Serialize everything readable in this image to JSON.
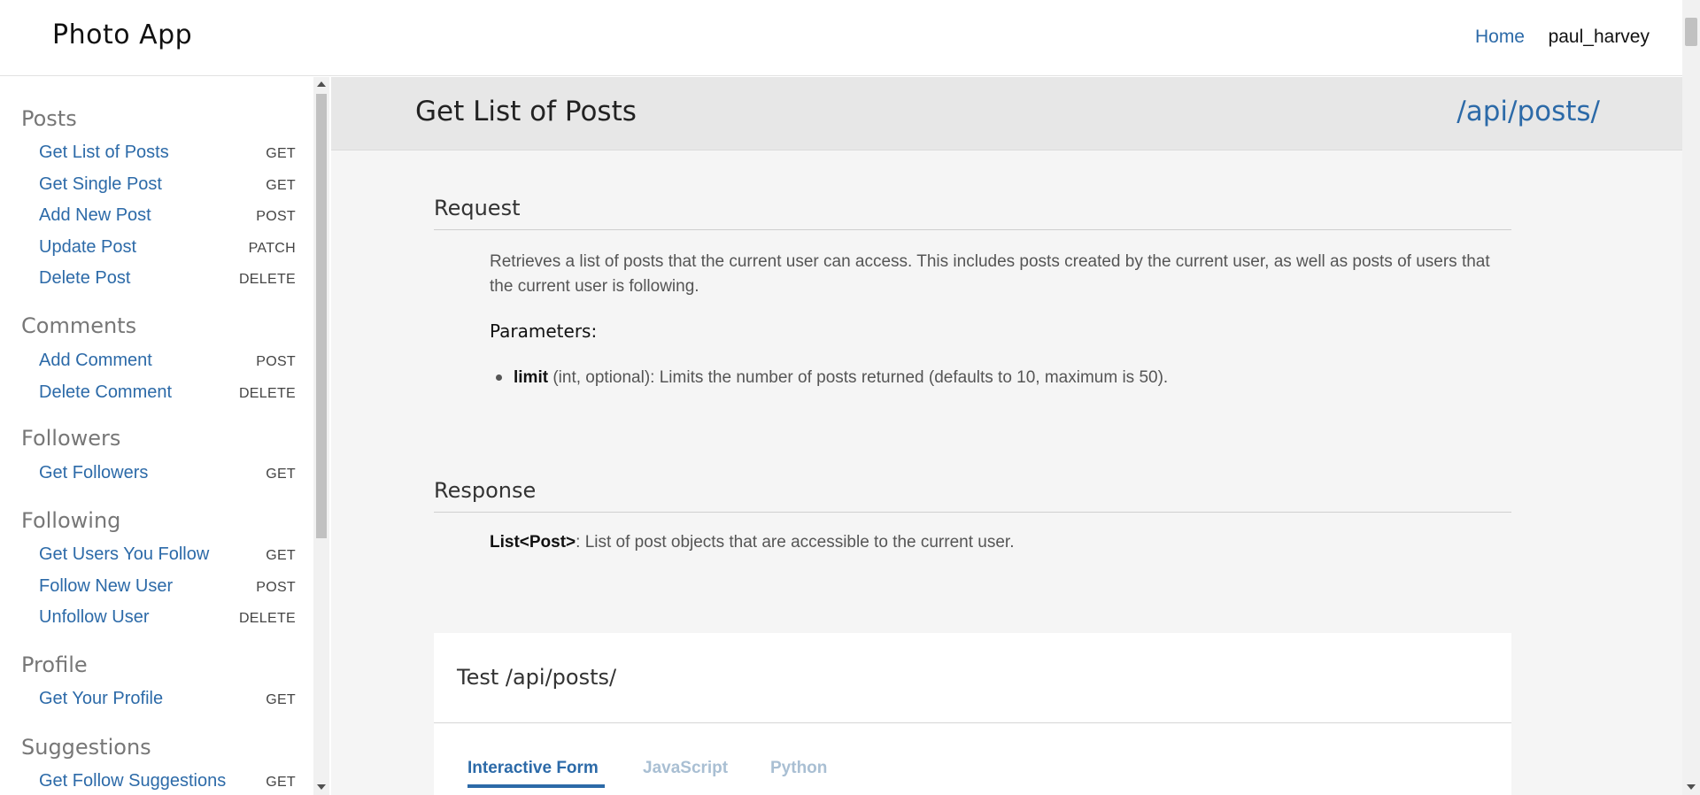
{
  "header": {
    "brand": "Photo App",
    "nav_home": "Home",
    "username": "paul_harvey"
  },
  "sidebar": {
    "sections": [
      {
        "title": "Posts",
        "items": [
          {
            "label": "Get List of Posts",
            "method": "GET"
          },
          {
            "label": "Get Single Post",
            "method": "GET"
          },
          {
            "label": "Add New Post",
            "method": "POST"
          },
          {
            "label": "Update Post",
            "method": "PATCH"
          },
          {
            "label": "Delete Post",
            "method": "DELETE"
          }
        ]
      },
      {
        "title": "Comments",
        "items": [
          {
            "label": "Add Comment",
            "method": "POST"
          },
          {
            "label": "Delete Comment",
            "method": "DELETE"
          }
        ]
      },
      {
        "title": "Followers",
        "items": [
          {
            "label": "Get Followers",
            "method": "GET"
          }
        ]
      },
      {
        "title": "Following",
        "items": [
          {
            "label": "Get Users You Follow",
            "method": "GET"
          },
          {
            "label": "Follow New User",
            "method": "POST"
          },
          {
            "label": "Unfollow User",
            "method": "DELETE"
          }
        ]
      },
      {
        "title": "Profile",
        "items": [
          {
            "label": "Get Your Profile",
            "method": "GET"
          }
        ]
      },
      {
        "title": "Suggestions",
        "items": [
          {
            "label": "Get Follow Suggestions",
            "method": "GET"
          }
        ]
      }
    ]
  },
  "main": {
    "title": "Get List of Posts",
    "path": "/api/posts/",
    "request": {
      "heading": "Request",
      "description": "Retrieves a list of posts that the current user can access. This includes posts created by the current user, as well as posts of users that the current user is following.",
      "params_heading": "Parameters:",
      "params": [
        {
          "name": "limit",
          "desc": " (int, optional): Limits the number of posts returned (defaults to 10, maximum is 50)."
        }
      ]
    },
    "response": {
      "heading": "Response",
      "type": "List<Post>",
      "desc": ": List of post objects that are accessible to the current user."
    },
    "test": {
      "title": "Test /api/posts/",
      "tabs": [
        "Interactive Form",
        "JavaScript",
        "Python"
      ],
      "active_tab": "Interactive Form"
    }
  },
  "colors": {
    "link": "#2c6aa8",
    "inactive_tab": "#a9bfd3",
    "main_bg": "#f5f5f5",
    "bar_bg": "#e7e7e7"
  }
}
